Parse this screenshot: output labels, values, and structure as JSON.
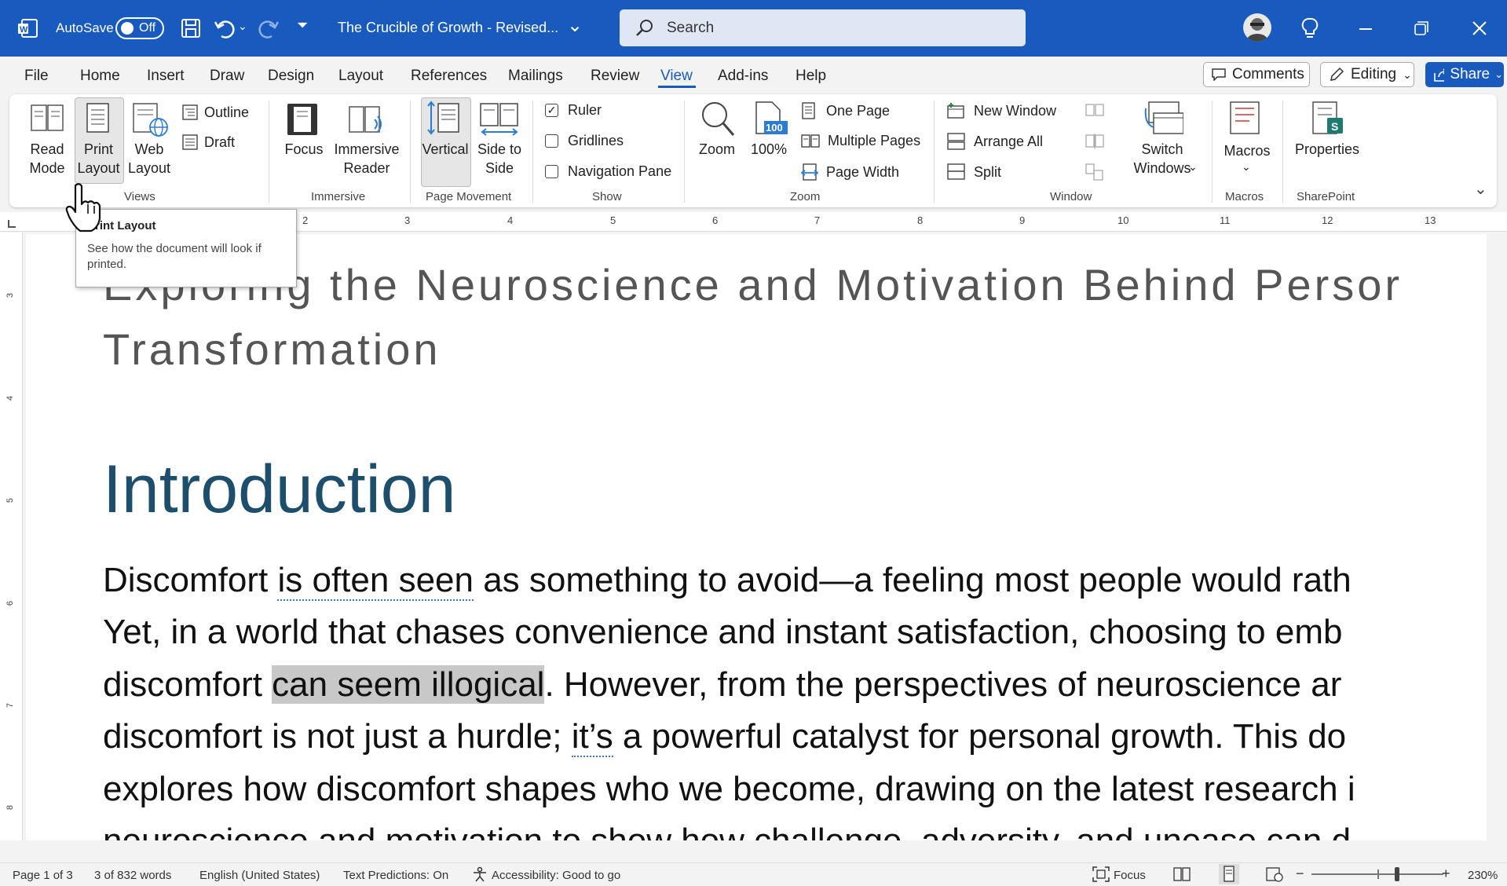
{
  "titlebar": {
    "app_icon": "word-icon",
    "autosave_label": "AutoSave",
    "autosave_state": "Off",
    "doc_title": "The Crucible of Growth - Revised...",
    "search_placeholder": "Search"
  },
  "menu": {
    "items": [
      "File",
      "Home",
      "Insert",
      "Draw",
      "Design",
      "Layout",
      "References",
      "Mailings",
      "Review",
      "View",
      "Add-ins",
      "Help"
    ],
    "active": "View",
    "comments_label": "Comments",
    "editing_label": "Editing",
    "share_label": "Share"
  },
  "ribbon": {
    "views": {
      "read_mode": "Read Mode",
      "print_layout": "Print Layout",
      "web_layout": "Web Layout",
      "outline": "Outline",
      "draft": "Draft",
      "group": "Views"
    },
    "immersive": {
      "focus": "Focus",
      "immersive_reader": "Immersive Reader",
      "group": "Immersive"
    },
    "page_movement": {
      "vertical": "Vertical",
      "side_to_side": "Side to Side",
      "group": "Page Movement"
    },
    "show": {
      "ruler": "Ruler",
      "ruler_checked": true,
      "gridlines": "Gridlines",
      "gridlines_checked": false,
      "navigation_pane": "Navigation Pane",
      "navigation_pane_checked": false,
      "group": "Show"
    },
    "zoom": {
      "zoom": "Zoom",
      "percent": "100%",
      "one_page": "One Page",
      "multiple_pages": "Multiple Pages",
      "page_width": "Page Width",
      "group": "Zoom",
      "badge": "100"
    },
    "window": {
      "new_window": "New Window",
      "arrange_all": "Arrange All",
      "split": "Split",
      "switch_windows": "Switch Windows",
      "group": "Window"
    },
    "macros": {
      "macros": "Macros",
      "group": "Macros"
    },
    "sharepoint": {
      "properties": "Properties",
      "group": "SharePoint"
    }
  },
  "ruler": {
    "numbers": [
      "2",
      "3",
      "4",
      "5",
      "6",
      "7",
      "8",
      "9",
      "10",
      "11",
      "12",
      "13"
    ],
    "vnumbers": [
      "3",
      "4",
      "5",
      "6",
      "7",
      "8"
    ]
  },
  "tooltip": {
    "title": "Print Layout",
    "description": "See how the document will look if printed."
  },
  "document": {
    "subtitle_line1": "Exploring the Neuroscience and Motivation Behind Persor",
    "subtitle_line2": "Transformation",
    "heading": "Introduction",
    "p1_a": "Discomfort ",
    "p1_b": "is often seen",
    "p1_c": " as something to avoid—a feeling most people would rath",
    "p2": "Yet, in a world that chases convenience and instant satisfaction, choosing to emb",
    "p3_a": "discomfort ",
    "p3_b": "can seem illogical",
    "p3_c": ". However, from the perspectives of neuroscience ar",
    "p4_a": "discomfort is not just a hurdle; ",
    "p4_b": "it’s",
    "p4_c": " a powerful catalyst for personal growth. This do",
    "p5": "explores how discomfort shapes who we become, drawing on the latest research i",
    "p6": "neuroscience and motivation to show how challenge, adversity, and unease can d"
  },
  "status": {
    "page": "Page 1 of 3",
    "words": "3 of 832 words",
    "language": "English (United States)",
    "predictions": "Text Predictions: On",
    "accessibility": "Accessibility: Good to go",
    "focus": "Focus",
    "zoom": "230%"
  }
}
